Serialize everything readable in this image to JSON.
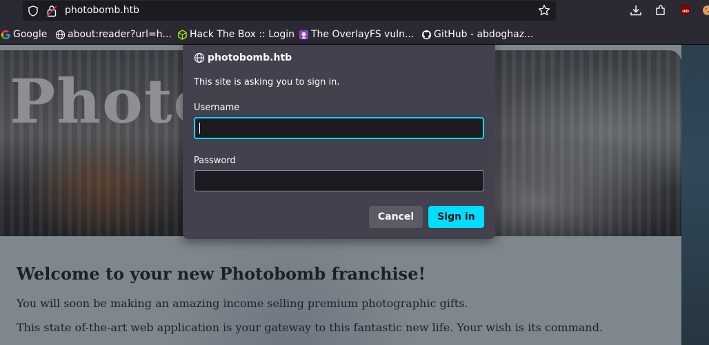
{
  "browser": {
    "url": "photobomb.htb",
    "icons": [
      "shield-icon",
      "lock-icon",
      "star-icon",
      "download-icon",
      "extensions-icon",
      "ublock-icon",
      "cookie-icon"
    ]
  },
  "bookmarks": [
    {
      "label": "Google",
      "icon": "google-icon"
    },
    {
      "label": "about:reader?url=h...",
      "icon": "globe-icon"
    },
    {
      "label": "Hack The Box :: Login",
      "icon": "htb-icon"
    },
    {
      "label": "The OverlayFS vuln...",
      "icon": "seal-icon"
    },
    {
      "label": "GitHub - abdoghaz...",
      "icon": "github-icon"
    }
  ],
  "page": {
    "hero_title": "Photo",
    "welcome": "Welcome to your new Photobomb franchise!",
    "para1": "You will soon be making an amazing income selling premium photographic gifts.",
    "para2": "This state of-the-art web application is your gateway to this fantastic new life. Your wish is its command."
  },
  "dialog": {
    "host": "photobomb.htb",
    "message": "This site is asking you to sign in.",
    "username_label": "Username",
    "username_value": "",
    "password_label": "Password",
    "password_value": "",
    "cancel_label": "Cancel",
    "signin_label": "Sign in"
  },
  "colors": {
    "accent": "#00ddff",
    "dialog_bg": "#42414d",
    "chrome_bg": "#2b2a33"
  }
}
